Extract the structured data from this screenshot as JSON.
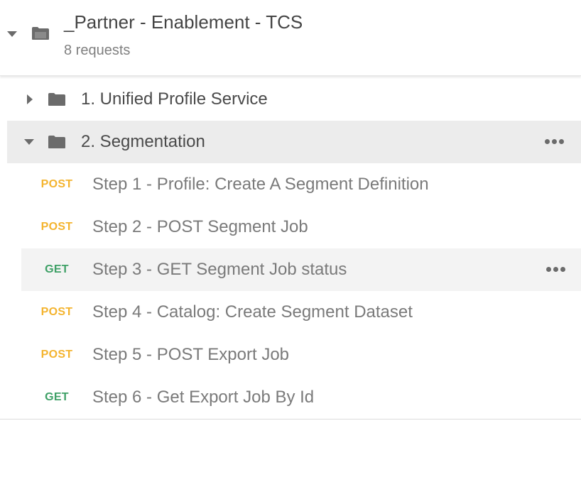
{
  "collection": {
    "title": "_Partner - Enablement - TCS",
    "meta": "8 requests",
    "expanded": true,
    "caret_icon": "caret-down-icon",
    "folder_icon": "folder-open-icon"
  },
  "folders": [
    {
      "label": "1. Unified Profile Service",
      "expanded": false,
      "caret_icon": "caret-right-icon",
      "folder_icon": "folder-icon"
    },
    {
      "label": "2. Segmentation",
      "expanded": true,
      "caret_icon": "caret-down-icon",
      "folder_icon": "folder-icon",
      "menu_icon": "more-dots-icon"
    }
  ],
  "requests": [
    {
      "method": "POST",
      "name": "Step 1 - Profile: Create A Segment Definition"
    },
    {
      "method": "POST",
      "name": "Step 2 - POST Segment Job"
    },
    {
      "method": "GET",
      "name": "Step 3 - GET Segment Job status",
      "menu_icon": "more-dots-icon"
    },
    {
      "method": "POST",
      "name": "Step 4 - Catalog: Create Segment Dataset"
    },
    {
      "method": "POST",
      "name": "Step 5 - POST Export Job"
    },
    {
      "method": "GET",
      "name": "Step 6 - Get Export Job By Id"
    }
  ],
  "colors": {
    "post": "#f4b42f",
    "get": "#3ea066",
    "active_folder_bg": "#ececec",
    "hover_row_bg": "#f3f3f3"
  }
}
